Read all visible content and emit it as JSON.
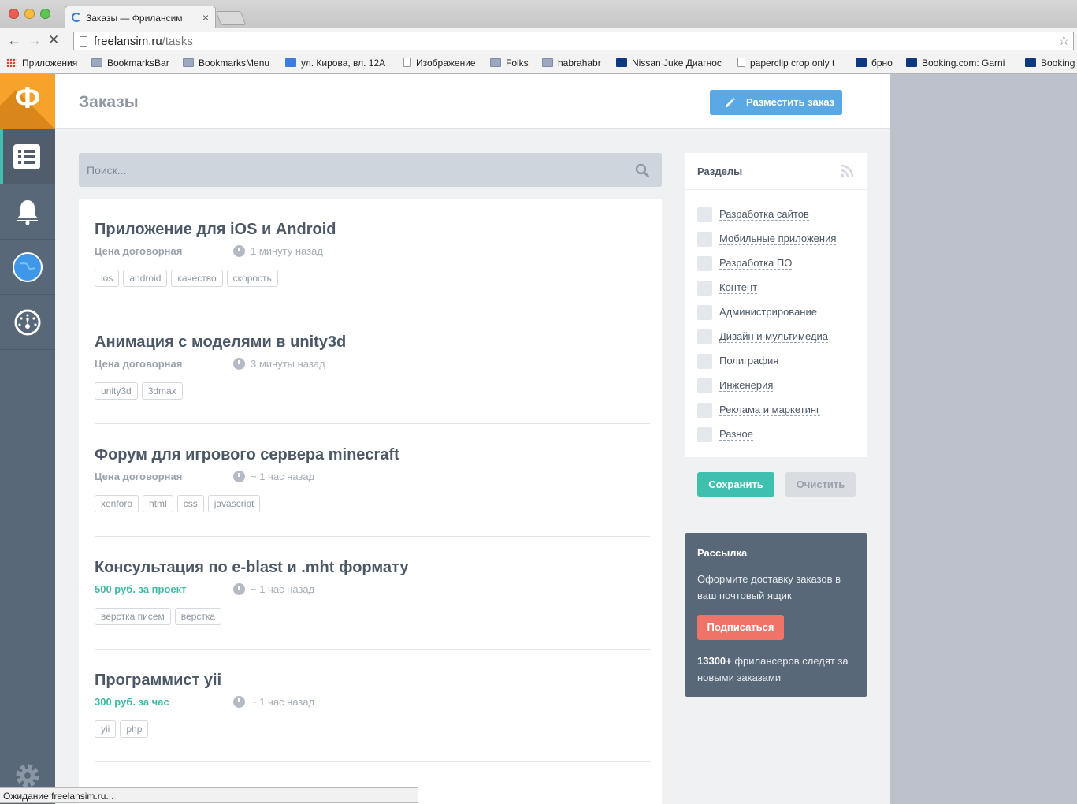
{
  "browser": {
    "tab_title": "Заказы — Фрилансим",
    "url_domain": "freelansim.ru",
    "url_path": "/tasks",
    "bookmarks": [
      {
        "label": "Приложения",
        "icon": "apps-grid-icon"
      },
      {
        "label": "BookmarksBar",
        "icon": "folder-icon"
      },
      {
        "label": "BookmarksMenu",
        "icon": "folder-icon"
      },
      {
        "label": "ул. Кирова, вл. 12А",
        "icon": "google-icon"
      },
      {
        "label": "Изображение",
        "icon": "page-icon"
      },
      {
        "label": "Folks",
        "icon": "folder-icon"
      },
      {
        "label": "habrahabr",
        "icon": "folder-icon"
      },
      {
        "label": "Nissan Juke Диагнос",
        "icon": "site-icon"
      },
      {
        "label": "paperclip crop only t",
        "icon": "page-icon"
      },
      {
        "label": "брно",
        "icon": "booking-icon"
      },
      {
        "label": "Booking.com: Garni",
        "icon": "booking-icon"
      },
      {
        "label": "Booking",
        "icon": "booking-icon"
      }
    ],
    "status_text": "Ожидание freelansim.ru..."
  },
  "sidebar": {
    "logo_glyph": "Ф",
    "items": [
      {
        "name": "tasks",
        "icon": "list-icon",
        "active": true
      },
      {
        "name": "notifications",
        "icon": "bell-icon",
        "active": false
      },
      {
        "name": "freelancers",
        "icon": "globe-icon",
        "active": false
      },
      {
        "name": "dashboard",
        "icon": "speedometer-icon",
        "active": false
      }
    ],
    "settings_icon": "gear-icon"
  },
  "header": {
    "title": "Заказы",
    "post_button": "Разместить заказ"
  },
  "search": {
    "placeholder": "Поиск...",
    "value": ""
  },
  "tasks": [
    {
      "title": "Приложение для iOS и Android",
      "price": "Цена договорная",
      "paid": false,
      "time": "1 минуту назад",
      "tags": [
        "ios",
        "android",
        "качество",
        "скорость"
      ]
    },
    {
      "title": "Анимация с моделями в unity3d",
      "price": "Цена договорная",
      "paid": false,
      "time": "3 минуты назад",
      "tags": [
        "unity3d",
        "3dmax"
      ]
    },
    {
      "title": "Форум для игрового сервера minecraft",
      "price": "Цена договорная",
      "paid": false,
      "time": "~ 1 час назад",
      "tags": [
        "xenforo",
        "html",
        "css",
        "javascript"
      ]
    },
    {
      "title": "Консультация по e-blast и .mht формату",
      "price": "500 руб. за проект",
      "paid": true,
      "time": "~ 1 час назад",
      "tags": [
        "верстка писем",
        "верстка"
      ]
    },
    {
      "title": "Программист yii",
      "price": "300 руб. за час",
      "paid": true,
      "time": "~ 1 час назад",
      "tags": [
        "yii",
        "php"
      ]
    }
  ],
  "sections": {
    "title": "Разделы",
    "categories": [
      "Разработка сайтов",
      "Мобильные приложения",
      "Разработка ПО",
      "Контент",
      "Администрирование",
      "Дизайн и мультимедиа",
      "Полиграфия",
      "Инженерия",
      "Реклама и маркетинг",
      "Разное"
    ],
    "save_label": "Сохранить",
    "clear_label": "Очистить"
  },
  "mailing": {
    "title": "Рассылка",
    "description": "Оформите доставку заказов в ваш почтовый ящик",
    "subscribe_label": "Подписаться",
    "stat_count": "13300+",
    "stat_text": " фрилансеров следят за новыми заказами"
  },
  "colors": {
    "accent_teal": "#3fbfad",
    "brand_orange": "#f6a22b",
    "sidebar_slate": "#596878",
    "button_blue": "#5ba9e4",
    "subscribe_red": "#ef7366"
  }
}
